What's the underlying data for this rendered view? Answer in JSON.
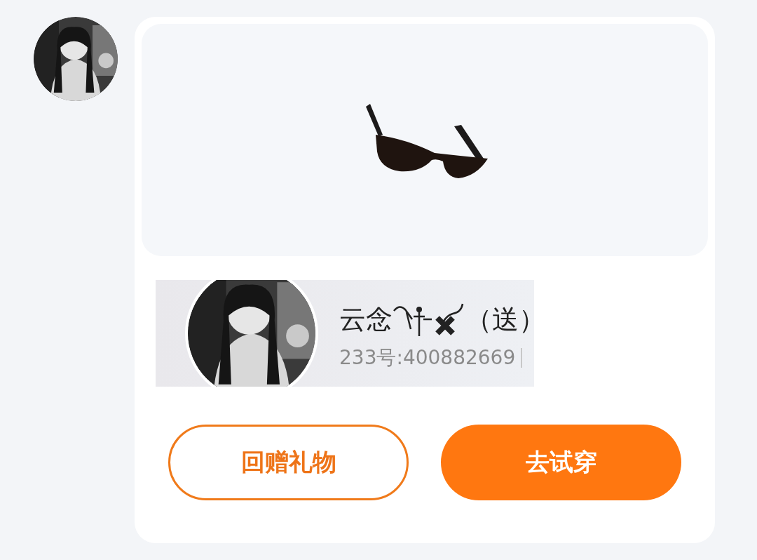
{
  "sender": {
    "name": "云念",
    "suffix": "（送）",
    "id_text": "233号:400882669"
  },
  "buttons": [
    {
      "label": "回赠礼物",
      "kind": "outline"
    },
    {
      "label": "去试穿",
      "kind": "filled"
    }
  ]
}
